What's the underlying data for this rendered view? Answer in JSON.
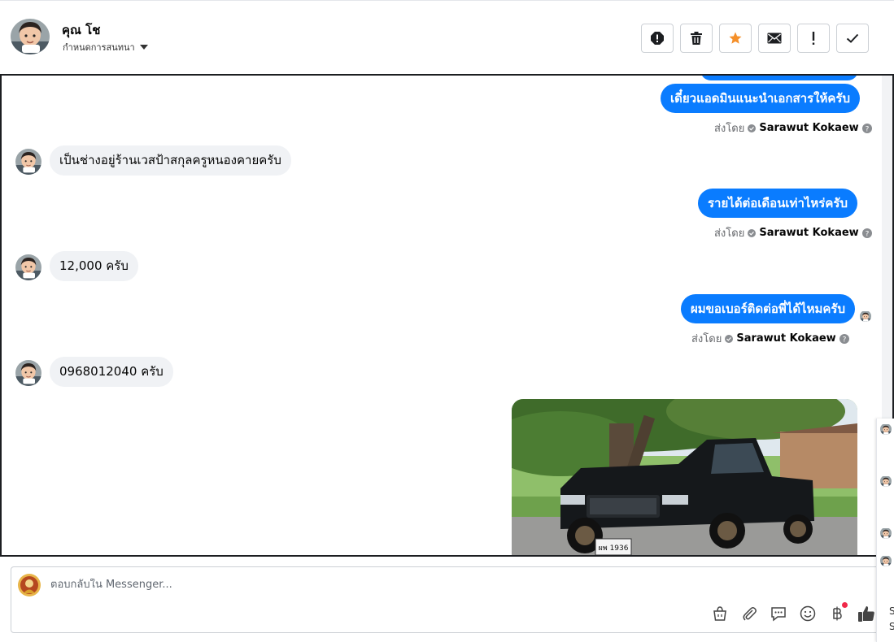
{
  "header": {
    "name": "คุณ โช",
    "subtitle": "กำหนดการสนทนา",
    "actions": [
      "report-icon",
      "trash-icon",
      "star-icon",
      "mail-icon",
      "exclamation-icon",
      "check-icon"
    ]
  },
  "messages": {
    "out1": "เดี๋ยวแอดมินแนะนำเอกสารให้ครับ",
    "in1": "เป็นช่างอยู่ร้านเวสป้าสกุลครูหนองคายครับ",
    "out2": "รายได้ต่อเดือนเท่าไหร่ครับ",
    "in2": "12,000 ครับ",
    "out3": "ผมขอเบอร์ติดต่อพี่ได้ไหมครับ",
    "in3": "0968012040 ครับ",
    "sent_by_label": "ส่งโดย",
    "sender": "Sarawut Kokaew",
    "plate": "ผพ 1936"
  },
  "composer": {
    "placeholder": "ตอบกลับใน Messenger..."
  },
  "tools": [
    "shopping-bag-icon",
    "paperclip-icon",
    "saved-reply-icon",
    "emoji-icon",
    "baht-icon",
    "thumbs-up-icon"
  ],
  "edge": {
    "letter_s1": "S",
    "letter_s2": "S"
  },
  "colors": {
    "accent": "#0a7cff",
    "incoming": "#f0f2f5",
    "star": "#f5902a",
    "badge": "#f02849"
  }
}
